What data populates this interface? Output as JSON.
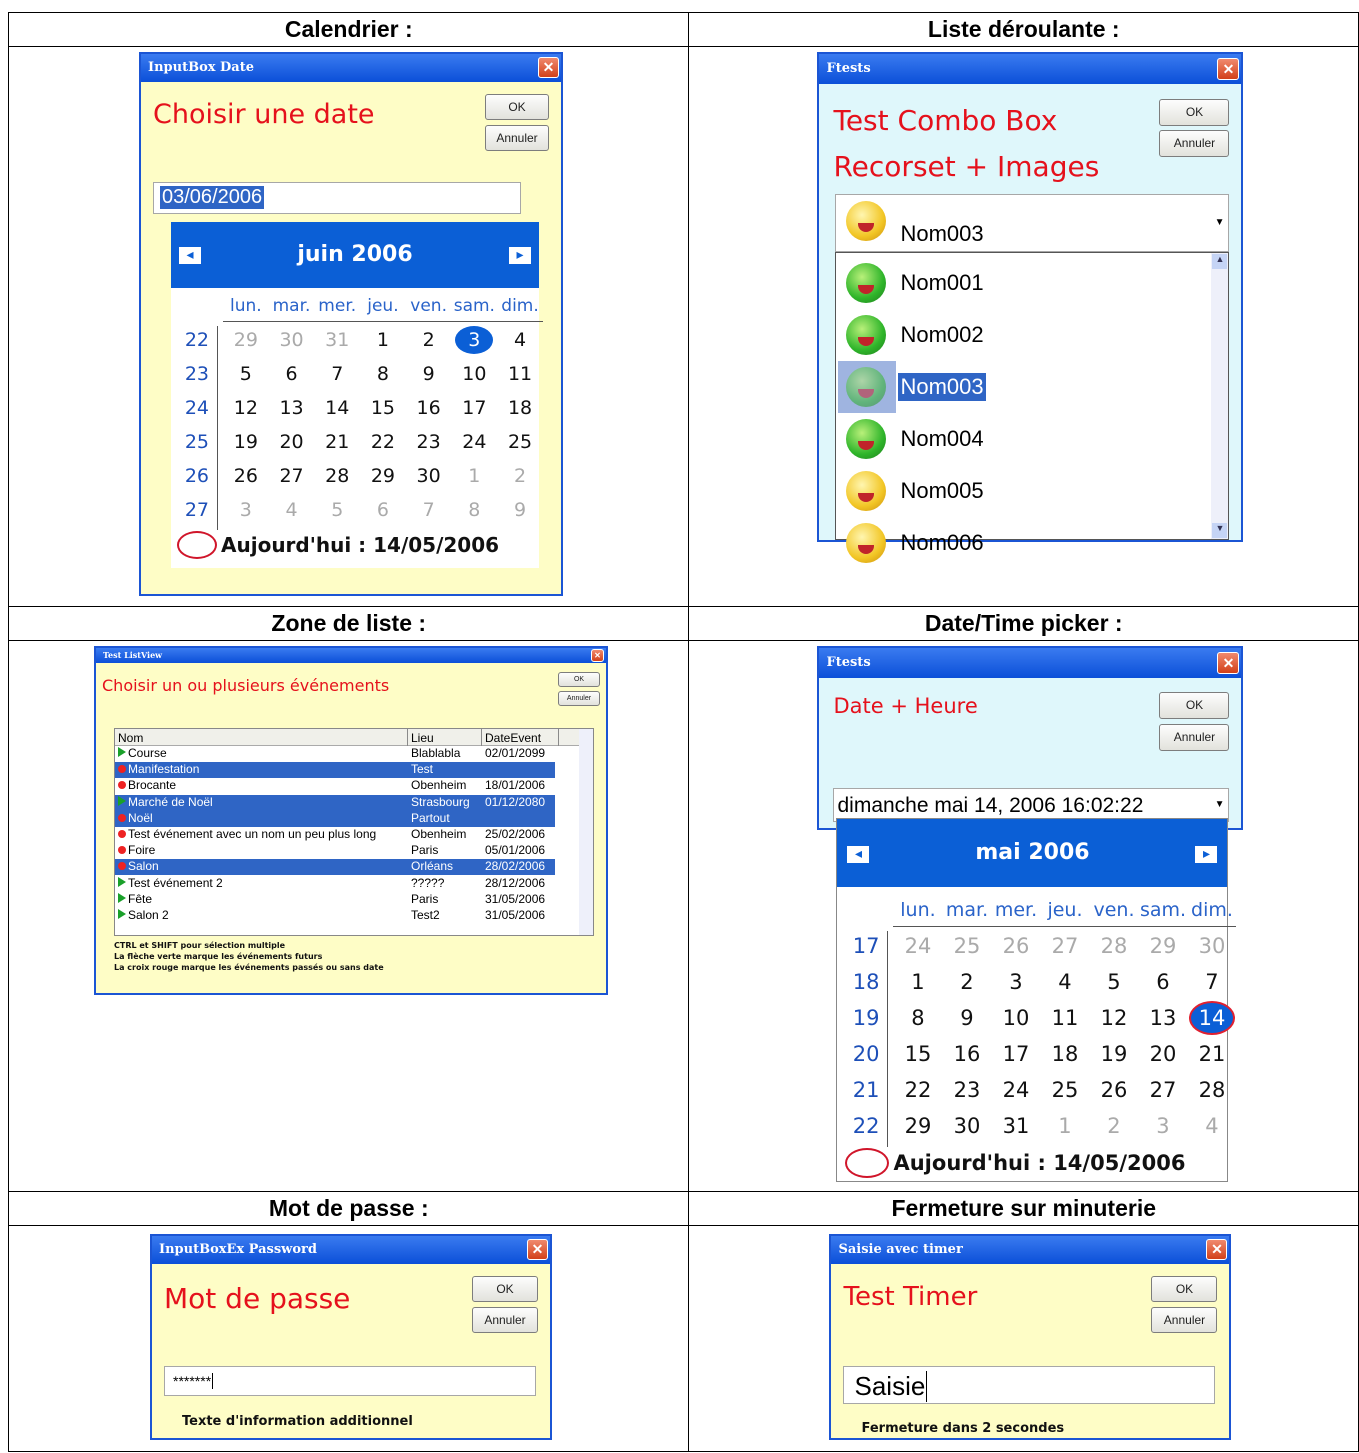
{
  "headers": {
    "calendar": "Calendrier :",
    "dropdown": "Liste déroulante :",
    "listbox": "Zone de liste :",
    "datetime": "Date/Time picker :",
    "password": "Mot de passe :",
    "timer": "Fermeture sur minuterie"
  },
  "common": {
    "ok": "OK",
    "cancel": "Annuler",
    "close": "✕"
  },
  "calendar": {
    "title": "InputBox Date",
    "prompt": "Choisir une date",
    "value": "03/06/2006",
    "month": "juin 2006",
    "prev": "◂",
    "next": "▸",
    "days": [
      "lun.",
      "mar.",
      "mer.",
      "jeu.",
      "ven.",
      "sam.",
      "dim."
    ],
    "weeks": [
      "22",
      "23",
      "24",
      "25",
      "26",
      "27"
    ],
    "rows": [
      [
        "29",
        "30",
        "31",
        "1",
        "2",
        "3",
        "4"
      ],
      [
        "5",
        "6",
        "7",
        "8",
        "9",
        "10",
        "11"
      ],
      [
        "12",
        "13",
        "14",
        "15",
        "16",
        "17",
        "18"
      ],
      [
        "19",
        "20",
        "21",
        "22",
        "23",
        "24",
        "25"
      ],
      [
        "26",
        "27",
        "28",
        "29",
        "30",
        "1",
        "2"
      ],
      [
        "3",
        "4",
        "5",
        "6",
        "7",
        "8",
        "9"
      ]
    ],
    "today_label": "Aujourd'hui : 14/05/2006"
  },
  "combo": {
    "title": "Ftests",
    "line1": "Test Combo Box",
    "line2": "Recorset + Images",
    "selected": "Nom003",
    "items": [
      "Nom001",
      "Nom002",
      "Nom003",
      "Nom004",
      "Nom005",
      "Nom006"
    ]
  },
  "listview": {
    "title": "Test ListView",
    "prompt": "Choisir un ou plusieurs événements",
    "columns": [
      "Nom",
      "Lieu",
      "DateEvent"
    ],
    "rows": [
      [
        "Course",
        "Blablabla",
        "02/01/2099"
      ],
      [
        "Manifestation",
        "Test",
        ""
      ],
      [
        "Brocante",
        "Obenheim",
        "18/01/2006"
      ],
      [
        "Marché de Noël",
        "Strasbourg",
        "01/12/2080"
      ],
      [
        "Noël",
        "Partout",
        ""
      ],
      [
        "Test événement avec un nom un peu plus long",
        "Obenheim",
        "25/02/2006"
      ],
      [
        "Foire",
        "Paris",
        "05/01/2006"
      ],
      [
        "Salon",
        "Orléans",
        "28/02/2006"
      ],
      [
        "Test événement 2",
        "?????",
        "28/12/2006"
      ],
      [
        "Fête",
        "Paris",
        "31/05/2006"
      ],
      [
        "Salon 2",
        "Test2",
        "31/05/2006"
      ]
    ],
    "notes": [
      "CTRL et SHIFT pour sélection multiple",
      "La flèche verte marque les événements futurs",
      "La croix rouge marque les événements passés ou sans date"
    ]
  },
  "datetime": {
    "title": "Ftests",
    "prompt": "Date + Heure",
    "value": "dimanche mai 14, 2006 16:02:22",
    "month": "mai 2006",
    "weeks": [
      "17",
      "18",
      "19",
      "20",
      "21",
      "22"
    ],
    "rows": [
      [
        "24",
        "25",
        "26",
        "27",
        "28",
        "29",
        "30"
      ],
      [
        "1",
        "2",
        "3",
        "4",
        "5",
        "6",
        "7"
      ],
      [
        "8",
        "9",
        "10",
        "11",
        "12",
        "13",
        "14"
      ],
      [
        "15",
        "16",
        "17",
        "18",
        "19",
        "20",
        "21"
      ],
      [
        "22",
        "23",
        "24",
        "25",
        "26",
        "27",
        "28"
      ],
      [
        "29",
        "30",
        "31",
        "1",
        "2",
        "3",
        "4"
      ]
    ],
    "today_label": "Aujourd'hui : 14/05/2006"
  },
  "password": {
    "title": "InputBoxEx Password",
    "prompt": "Mot de passe",
    "value": "*******",
    "info": "Texte d'information additionnel"
  },
  "timer": {
    "title": "Saisie avec timer",
    "prompt": "Test Timer",
    "value": "Saisie",
    "info": "Fermeture dans  2 secondes"
  }
}
